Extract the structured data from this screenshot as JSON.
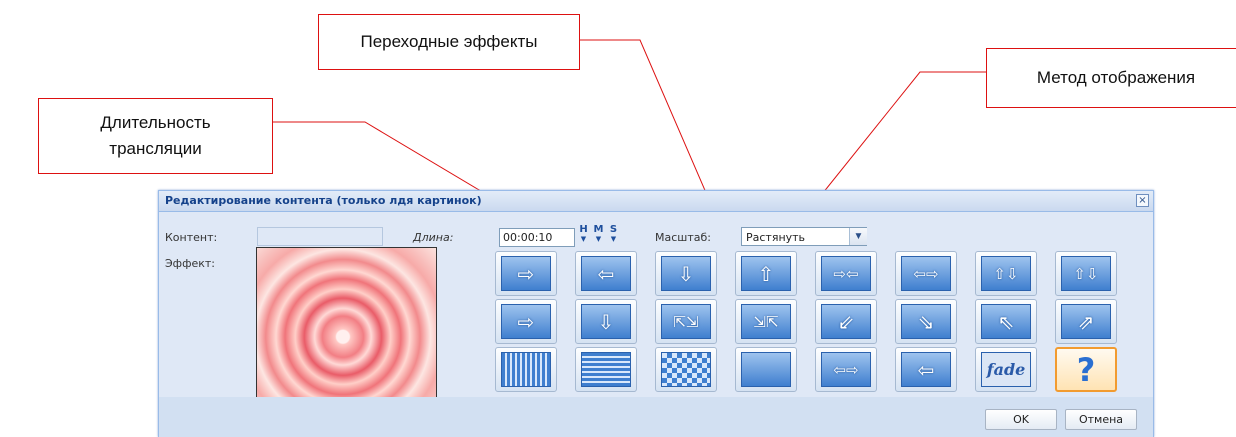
{
  "callouts": {
    "length_line1": "Длительность",
    "length_line2": "трансляции",
    "effects": "Переходные эффекты",
    "display": "Метод отображения"
  },
  "dialog": {
    "title": "Редактирование контента (только лдя картинок)",
    "close": "×"
  },
  "form": {
    "content_label": "Контент:",
    "content_value": "",
    "effect_label": "Эффект:",
    "length_label": "Длина:",
    "length_value": "00:00:10",
    "hms": [
      "H",
      "M",
      "S"
    ],
    "scale_label": "Масштаб:",
    "scale_value": "Растянуть"
  },
  "effects": [
    {
      "icon": "push-right-icon",
      "glyph": "⇨"
    },
    {
      "icon": "push-left-icon",
      "glyph": "⇦"
    },
    {
      "icon": "push-down-icon",
      "glyph": "⇩"
    },
    {
      "icon": "push-up-icon",
      "glyph": "⇧"
    },
    {
      "icon": "split-in-horizontal-icon",
      "glyph": "⇨⇦"
    },
    {
      "icon": "split-out-horizontal-icon",
      "glyph": "⇦⇨"
    },
    {
      "icon": "split-in-vertical-icon",
      "glyph": "⇧⇩"
    },
    {
      "icon": "split-out-vertical-icon",
      "glyph": "⇧⇩"
    },
    {
      "icon": "blinds-right-icon",
      "glyph": "⇨"
    },
    {
      "icon": "blinds-down-icon",
      "glyph": "⇩"
    },
    {
      "icon": "zoom-out-corners-icon",
      "glyph": "⇱⇲"
    },
    {
      "icon": "zoom-in-corners-icon",
      "glyph": "⇲⇱"
    },
    {
      "icon": "stairs-down-left-icon",
      "glyph": "⇙"
    },
    {
      "icon": "stairs-down-right-icon",
      "glyph": "⇘"
    },
    {
      "icon": "stairs-up-left-icon",
      "glyph": "⇖"
    },
    {
      "icon": "stairs-up-right-icon",
      "glyph": "⇗"
    },
    {
      "icon": "vertical-stripes-icon",
      "glyph": ""
    },
    {
      "icon": "horizontal-stripes-icon",
      "glyph": ""
    },
    {
      "icon": "checkerboard-icon",
      "glyph": ""
    },
    {
      "icon": "solid-blue-icon",
      "glyph": ""
    },
    {
      "icon": "interleave-icon",
      "glyph": "⇦⇨"
    },
    {
      "icon": "cover-left-icon",
      "glyph": "⇦"
    },
    {
      "icon": "fade-icon",
      "glyph": "fade"
    },
    {
      "icon": "random-icon",
      "glyph": "?"
    }
  ],
  "buttons": {
    "ok": "OK",
    "cancel": "Отмена"
  }
}
